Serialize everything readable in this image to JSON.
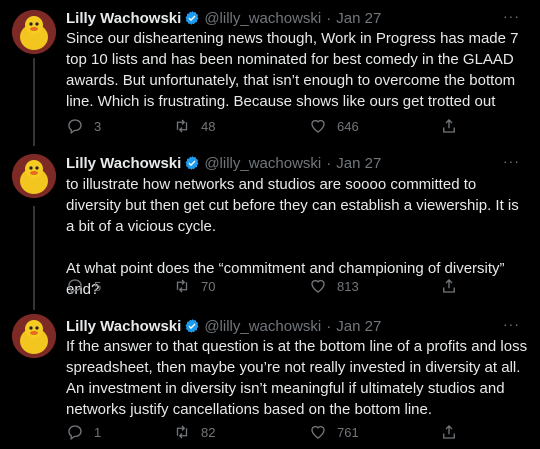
{
  "tweets": [
    {
      "author": "Lilly Wachowski",
      "handle": "@lilly_wachowski",
      "separator": "·",
      "date": "Jan 27",
      "more": "···",
      "paragraphs": [
        "Since our disheartening news though, Work in Progress has made 7 top 10 lists and has been nominated for best comedy in the GLAAD awards. But unfortunately, that isn’t enough to overcome the bottom line. Which is frustrating. Because shows like ours get trotted out"
      ],
      "replies": "3",
      "retweets": "48",
      "likes": "646"
    },
    {
      "author": "Lilly Wachowski",
      "handle": "@lilly_wachowski",
      "separator": "·",
      "date": "Jan 27",
      "more": "···",
      "paragraphs": [
        "to illustrate how networks and studios are soooo committed to diversity but then get cut before they can establish a viewership. It is a bit of a vicious cycle.",
        "At what point does the “commitment and championing of diversity” end?"
      ],
      "replies": "5",
      "retweets": "70",
      "likes": "813"
    },
    {
      "author": "Lilly Wachowski",
      "handle": "@lilly_wachowski",
      "separator": "·",
      "date": "Jan 27",
      "more": "···",
      "paragraphs": [
        "If the answer to that question is at the bottom line of a profits and loss spreadsheet, then maybe you’re not really invested in diversity at all.  An investment in diversity isn’t meaningful if ultimately studios and networks justify cancellations based on the bottom line."
      ],
      "replies": "1",
      "retweets": "82",
      "likes": "761"
    }
  ],
  "colors": {
    "background": "#000000",
    "text": "#e7e9ea",
    "muted": "#71767b",
    "verified": "#1d9bf0",
    "thread_line": "#333639"
  },
  "icons": [
    "verified-badge-icon",
    "more-icon",
    "reply-icon",
    "retweet-icon",
    "like-icon",
    "share-icon"
  ]
}
